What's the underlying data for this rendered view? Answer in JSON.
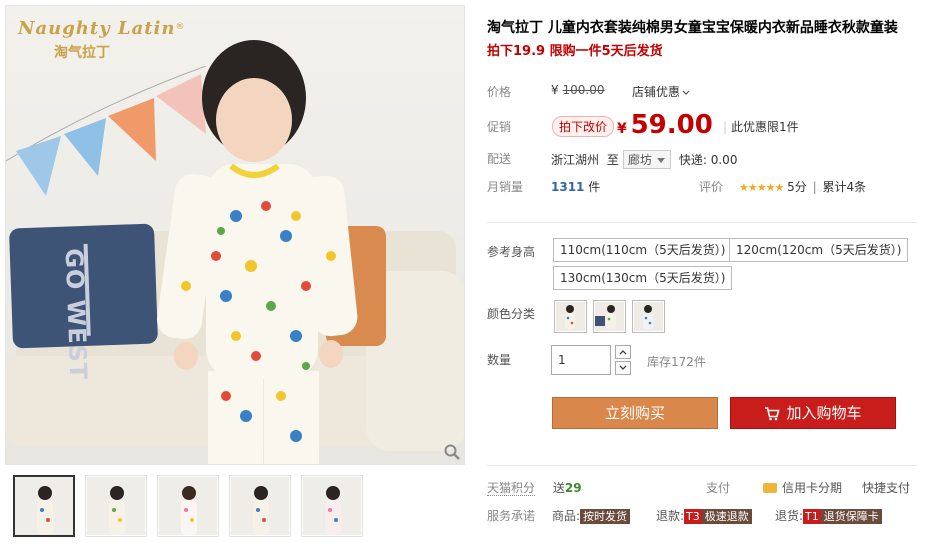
{
  "brand": {
    "en": "Naughty Latin",
    "cn": "淘气拉丁",
    "reg": "®"
  },
  "pillow_text": "GO WEST",
  "product": {
    "title": "淘气拉丁 儿童内衣套装纯棉男女童宝宝保暖内衣新品睡衣秋款童装",
    "subtitle": "拍下19.9 限购一件5天后发货"
  },
  "price": {
    "label": "价格",
    "currency": "¥",
    "original": "100.00",
    "store_promo": "店铺优惠"
  },
  "promo": {
    "label": "促销",
    "tag": "拍下改价",
    "currency": "¥",
    "price": "59.00",
    "limit": "此优惠限1件"
  },
  "shipping": {
    "label": "配送",
    "from": "浙江湖州",
    "to_word": "至",
    "dest": "廊坊",
    "express": "快递: 0.00"
  },
  "sales": {
    "label": "月销量",
    "count": "1311",
    "unit": "件",
    "rating_label": "评价",
    "stars": "★★★★★",
    "score": "5分",
    "total": "累计4条"
  },
  "options": {
    "size_label": "参考身高",
    "sizes": [
      "110cm(110cm（5天后发货）)",
      "120cm(120cm（5天后发货）)",
      "130cm(130cm（5天后发货）)"
    ],
    "color_label": "颜色分类",
    "qty_label": "数量",
    "qty_value": "1",
    "stock": "库存172件"
  },
  "buttons": {
    "buy": "立刻购买",
    "cart": "加入购物车"
  },
  "points": {
    "label": "天猫积分",
    "send": "送",
    "value": "29",
    "pay_label": "支付",
    "installment": "信用卡分期",
    "quick_pay": "快捷支付"
  },
  "service": {
    "label": "服务承诺",
    "goods": "商品:",
    "ontime": "按时发货",
    "refund": "退款:",
    "t3": "T3",
    "fast_refund": "极速退款",
    "return": "退货:",
    "t1": "T1",
    "return_guarantee": "退货保障卡"
  },
  "colors": {
    "price_red": "#c40000",
    "buy_orange": "#d9874a",
    "cart_red": "#c81d1a",
    "points_green": "#3a8a2a"
  }
}
